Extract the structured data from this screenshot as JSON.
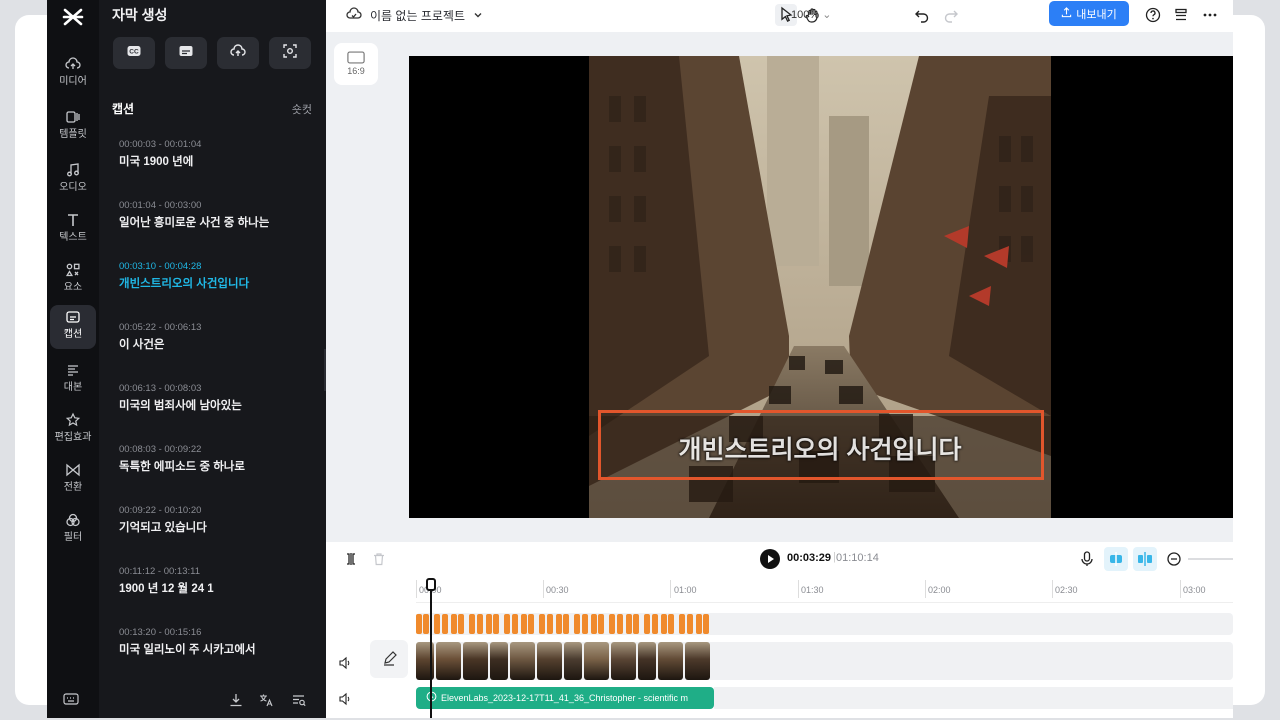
{
  "nav": {
    "items": [
      {
        "label": "미디어",
        "icon": "cloud-upload-icon"
      },
      {
        "label": "템플릿",
        "icon": "template-icon"
      },
      {
        "label": "오디오",
        "icon": "music-note-icon"
      },
      {
        "label": "텍스트",
        "icon": "text-icon"
      },
      {
        "label": "요소",
        "icon": "elements-icon"
      },
      {
        "label": "캡션",
        "icon": "caption-icon"
      },
      {
        "label": "대본",
        "icon": "script-icon"
      },
      {
        "label": "편집효과",
        "icon": "effects-star-icon"
      },
      {
        "label": "전환",
        "icon": "transition-icon"
      },
      {
        "label": "필터",
        "icon": "filter-icon"
      }
    ],
    "active": "캡션"
  },
  "panel": {
    "title": "자막 생성",
    "section_label": "캡션",
    "shortcut_label": "숏컷",
    "captions": [
      {
        "time": "00:00:03 - 00:01:04",
        "text": "미국 1900 년에"
      },
      {
        "time": "00:01:04 - 00:03:00",
        "text": "일어난 흥미로운 사건 중 하나는"
      },
      {
        "time": "00:03:10 - 00:04:28",
        "text": "개빈스트리오의 사건입니다"
      },
      {
        "time": "00:05:22 - 00:06:13",
        "text": "이 사건은"
      },
      {
        "time": "00:06:13 - 00:08:03",
        "text": "미국의 범죄사에 남아있는"
      },
      {
        "time": "00:08:03 - 00:09:22",
        "text": "독특한 에피소드 중 하나로"
      },
      {
        "time": "00:09:22 - 00:10:20",
        "text": "기억되고 있습니다"
      },
      {
        "time": "00:11:12 - 00:13:11",
        "text": "1900 년 12 월 24 1"
      },
      {
        "time": "00:13:20 - 00:15:16",
        "text": "미국 일리노이 주 시카고에서"
      }
    ],
    "selected_index": 2
  },
  "topbar": {
    "project_name": "이름 없는 프로젝트",
    "zoom": "100%",
    "export_label": "내보내기"
  },
  "canvas": {
    "ratio_label": "16:9",
    "subtitle_text": "개빈스트리오의 사건입니다"
  },
  "timeline": {
    "current_time": "00:03:29",
    "duration": "01:10:14",
    "ticks": [
      "00:00",
      "00:30",
      "01:00",
      "01:30",
      "02:00",
      "02:30",
      "03:00"
    ],
    "audio_clip_label": "ElevenLabs_2023-12-17T11_41_36_Christopher - scientific m"
  },
  "colors": {
    "accent": "#2c7ff6",
    "selected_caption": "#20b8e6",
    "highlight_box": "#e2562c",
    "audio_clip": "#1fae87",
    "caption_track": "#f08a2c"
  }
}
